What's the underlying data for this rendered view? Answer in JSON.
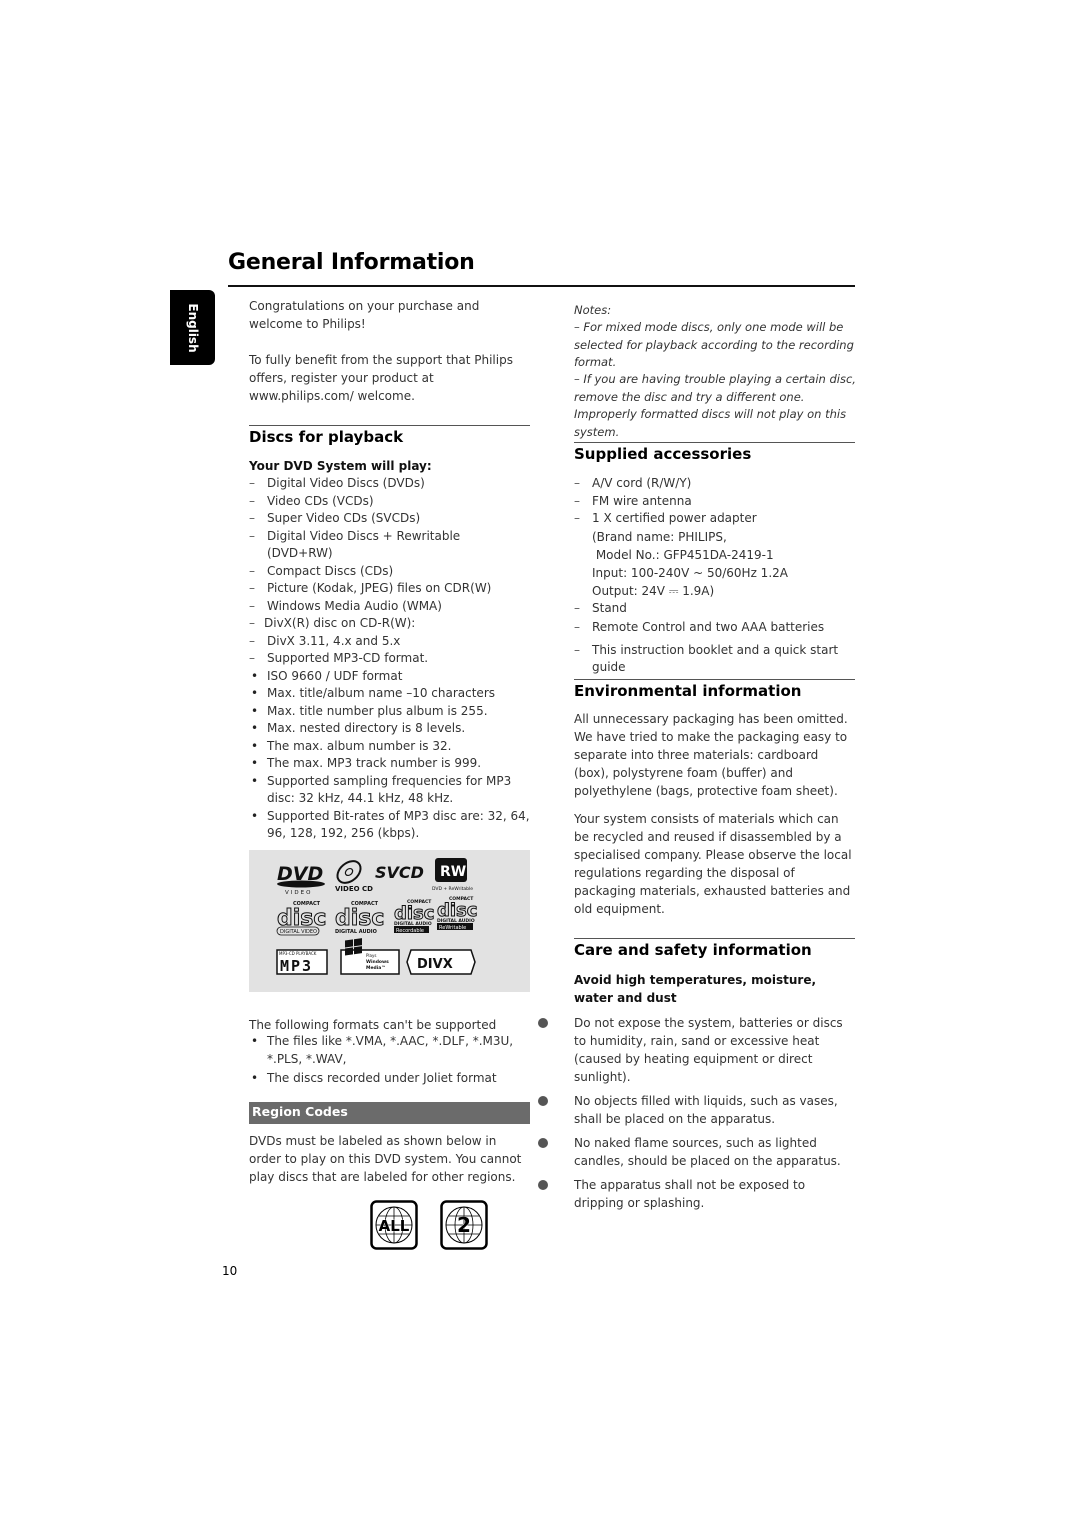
{
  "page": {
    "title": "General Information",
    "language_tab": "English",
    "page_number": "10"
  },
  "intro": {
    "p1": "Congratulations on your purchase and welcome to Philips!",
    "p2": "To fully benefit from the support that Philips offers, register your product at www.philips.com/ welcome."
  },
  "discs": {
    "heading": "Discs for playback",
    "subheading": "Your DVD System will play:",
    "dash_items": [
      "Digital Video Discs (DVDs)",
      "Video CDs (VCDs)",
      "Super Video CDs (SVCDs)",
      "Digital Video Discs + Rewritable (DVD+RW)",
      "Compact Discs (CDs)",
      "Picture (Kodak, JPEG) files on CDR(W)",
      "Windows Media Audio (WMA)",
      "DivX(R) disc on CD-R(W):",
      "DivX 3.11, 4.x and 5.x",
      "Supported MP3-CD format."
    ],
    "bullet_items": [
      "ISO 9660 / UDF format",
      "Max. title/album name –10 characters",
      "Max. title number plus album is 255.",
      "Max. nested directory is 8 levels.",
      "The max. album number is 32.",
      "The max. MP3 track number is 999.",
      "Supported sampling frequencies for MP3 disc: 32 kHz, 44.1 kHz, 48 kHz.",
      "Supported Bit-rates of MP3 disc are: 32, 64, 96, 128, 192, 256 (kbps)."
    ],
    "logos": {
      "dvd": "DVD",
      "dvd_sub": "VIDEO",
      "vcd": "VIDEO CD",
      "svcd": "SVCD",
      "rw": "RW",
      "rw_sub": "DVD + ReWritable",
      "disc_top": "COMPACT",
      "disc_word": "disc",
      "disc_labels": [
        "DIGITAL VIDEO",
        "DIGITAL AUDIO",
        "Recordable",
        "ReWritable"
      ],
      "disc_sub": "DIGITAL AUDIO",
      "mp3_top": "MP3-CD PLAYBACK",
      "mp3": "MP3",
      "wm_lines": [
        "Plays",
        "Windows",
        "Media™"
      ],
      "divx": "DIVX"
    },
    "unsupported_intro": "The following formats can't be supported",
    "unsupported_items": [
      "The files like *.VMA, *.AAC, *.DLF, *.M3U, *.PLS, *.WAV,",
      "The discs recorded under Joliet format"
    ]
  },
  "region": {
    "heading": "Region Codes",
    "text": "DVDs must be labeled as shown below in order to play on this DVD system. You cannot play discs that are labeled for other regions.",
    "badges": [
      "ALL",
      "2"
    ]
  },
  "notes": {
    "label": "Notes:",
    "items": [
      "–  For mixed mode discs, only one mode will be selected for playback according to the recording format.",
      "–  If you are having trouble playing a certain disc, remove the disc and try a different one. Improperly formatted discs will not play on this system."
    ]
  },
  "accessories": {
    "heading": "Supplied accessories",
    "items": [
      "A/V cord (R/W/Y)",
      "FM wire antenna",
      "1 X certified power adapter"
    ],
    "adapter_details": [
      "(Brand name: PHILIPS,",
      " Model No.: GFP451DA-2419-1",
      "Input: 100-240V ~ 50/60Hz 1.2A",
      "Output: 24V ⎓ 1.9A)"
    ],
    "items_after": [
      "Stand",
      "Remote Control and two AAA batteries",
      "This instruction booklet and a quick start guide"
    ]
  },
  "environment": {
    "heading": "Environmental information",
    "p1": "All unnecessary packaging has been omitted. We have tried to make the packaging easy to separate into three materials: cardboard (box), polystyrene foam (buffer) and polyethylene (bags, protective foam sheet).",
    "p2": "Your system consists of materials which can be recycled and reused if disassembled by a specialised company. Please observe the local regulations regarding the disposal of packaging materials, exhausted batteries and old equipment."
  },
  "safety": {
    "heading": "Care and safety information",
    "subheading": "Avoid high temperatures, moisture, water and dust",
    "items": [
      "Do not expose the system, batteries or discs to humidity, rain, sand or excessive heat (caused by heating equipment or direct sunlight).",
      "No objects filled with liquids, such as vases, shall be placed on the apparatus.",
      "No naked flame sources, such as lighted candles, should be placed on the apparatus.",
      "The apparatus shall not be exposed to dripping or splashing."
    ]
  }
}
